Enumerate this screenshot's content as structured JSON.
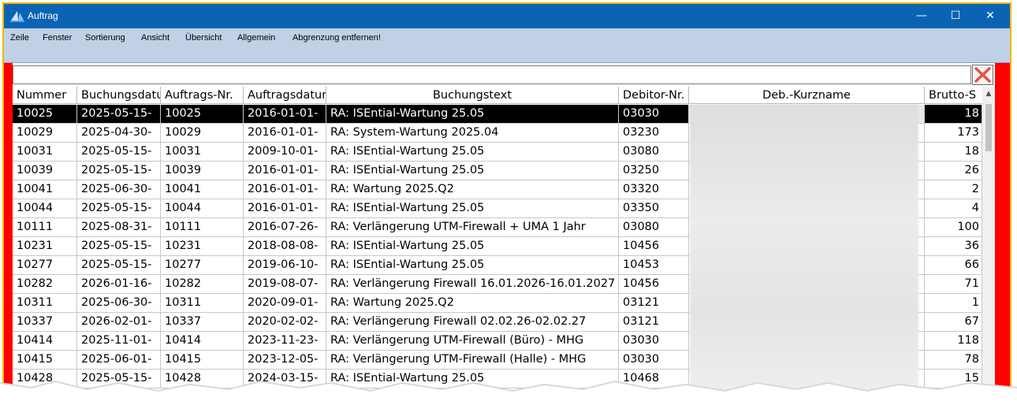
{
  "window": {
    "title": "Auftrag"
  },
  "menu": [
    "Zeile",
    "Fenster",
    "Sortierung",
    "Ansicht",
    "Übersicht",
    "Allgemein",
    "Abgrenzung entfernen!"
  ],
  "filter": {
    "value": ""
  },
  "columns": [
    "Nummer",
    "Buchungsdatum",
    "Auftrags-Nr.",
    "Auftragsdatum",
    "Buchungstext",
    "Debitor-Nr.",
    "Deb.-Kurzname",
    "Brutto-S"
  ],
  "rows": [
    [
      "10025",
      "2025-05-15-",
      "10025",
      "2016-01-01-",
      "RA: ISEntial-Wartung 25.05",
      "03030",
      "",
      "18"
    ],
    [
      "10029",
      "2025-04-30-",
      "10029",
      "2016-01-01-",
      "RA: System-Wartung 2025.04",
      "03230",
      "",
      "173"
    ],
    [
      "10031",
      "2025-05-15-",
      "10031",
      "2009-10-01-",
      "RA: ISEntial-Wartung 25.05",
      "03080",
      "",
      "18"
    ],
    [
      "10039",
      "2025-05-15-",
      "10039",
      "2016-01-01-",
      "RA: ISEntial-Wartung 25.05",
      "03250",
      "",
      "26"
    ],
    [
      "10041",
      "2025-06-30-",
      "10041",
      "2016-01-01-",
      "RA: Wartung 2025.Q2",
      "03320",
      "",
      "2"
    ],
    [
      "10044",
      "2025-05-15-",
      "10044",
      "2016-01-01-",
      "RA: ISEntial-Wartung 25.05",
      "03350",
      "",
      "4"
    ],
    [
      "10111",
      "2025-08-31-",
      "10111",
      "2016-07-26-",
      "RA: Verlängerung UTM-Firewall + UMA 1 Jahr",
      "03080",
      "",
      "100"
    ],
    [
      "10231",
      "2025-05-15-",
      "10231",
      "2018-08-08-",
      "RA: ISEntial-Wartung 25.05",
      "10456",
      "",
      "36"
    ],
    [
      "10277",
      "2025-05-15-",
      "10277",
      "2019-06-10-",
      "RA: ISEntial-Wartung 25.05",
      "10453",
      "",
      "66"
    ],
    [
      "10282",
      "2026-01-16-",
      "10282",
      "2019-08-07-",
      "RA: Verlängerung Firewall 16.01.2026-16.01.2027",
      "10456",
      "",
      "71"
    ],
    [
      "10311",
      "2025-06-30-",
      "10311",
      "2020-09-01-",
      "RA: Wartung 2025.Q2",
      "03121",
      "",
      "1"
    ],
    [
      "10337",
      "2026-02-01-",
      "10337",
      "2020-02-02-",
      "RA: Verlängerung Firewall 02.02.26-02.02.27",
      "03121",
      "",
      "67"
    ],
    [
      "10414",
      "2025-11-01-",
      "10414",
      "2023-11-23-",
      "RA: Verlängerung UTM-Firewall (Büro) - MHG",
      "03030",
      "",
      "118"
    ],
    [
      "10415",
      "2025-06-01-",
      "10415",
      "2023-12-05-",
      "RA: Verlängerung UTM-Firewall (Halle) - MHG",
      "03030",
      "",
      "78"
    ],
    [
      "10428",
      "2025-05-15-",
      "10428",
      "2024-03-15-",
      "RA: ISEntial-Wartung 25.05",
      "10468",
      "",
      "15"
    ]
  ],
  "colors": {
    "titlebar": "#0a64b3",
    "menubar": "#c0d1e6",
    "frame": "#f2b600",
    "side_panels": "#ff0000",
    "selection": "#000000"
  }
}
